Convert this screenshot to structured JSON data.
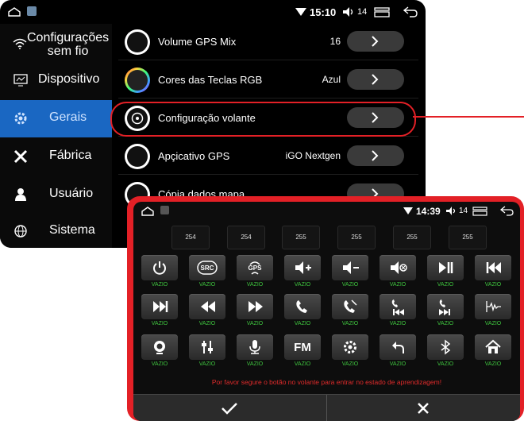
{
  "back_screen": {
    "status": {
      "time": "15:10",
      "volume": "14"
    },
    "sidebar": [
      {
        "label": "Configurações\nsem fio",
        "icon": "wifi-icon",
        "active": false
      },
      {
        "label": "Dispositivo",
        "icon": "device-icon",
        "active": false
      },
      {
        "label": "Gerais",
        "icon": "gear-icon",
        "active": true
      },
      {
        "label": "Fábrica",
        "icon": "tools-icon",
        "active": false
      },
      {
        "label": "Usuário",
        "icon": "user-icon",
        "active": false
      },
      {
        "label": "Sistema",
        "icon": "globe-icon",
        "active": false
      }
    ],
    "settings": [
      {
        "title": "Volume GPS Mix",
        "value": "16",
        "icon": "gps-mix-icon"
      },
      {
        "title": "Cores das Teclas RGB",
        "value": "Azul",
        "icon": "rgb-bulb-icon"
      },
      {
        "title": "Configuração volante",
        "value": "",
        "icon": "steering-wheel-icon"
      },
      {
        "title": "Apçicativo GPS",
        "value": "iGO Nextgen",
        "icon": "gps-app-icon"
      },
      {
        "title": "Cópia dados mapa",
        "value": "",
        "icon": "map-icon"
      }
    ]
  },
  "front_screen": {
    "status": {
      "time": "14:39",
      "volume": "14"
    },
    "codes": [
      "254",
      "254",
      "255",
      "255",
      "255",
      "255"
    ],
    "keys": [
      [
        {
          "icon": "power-icon",
          "status": "VAZIO"
        },
        {
          "icon": "src-icon",
          "text": "SRC",
          "status": "VAZIO"
        },
        {
          "icon": "gps-key-icon",
          "text": "GPS",
          "status": "VAZIO"
        },
        {
          "icon": "volume-up-icon",
          "status": "VAZIO"
        },
        {
          "icon": "volume-down-icon",
          "status": "VAZIO"
        },
        {
          "icon": "mute-icon",
          "status": "VAZIO"
        },
        {
          "icon": "play-pause-icon",
          "status": "VAZIO"
        },
        {
          "icon": "previous-track-icon",
          "status": "VAZIO"
        }
      ],
      [
        {
          "icon": "next-track-icon",
          "status": "VAZIO"
        },
        {
          "icon": "rewind-icon",
          "status": "VAZIO"
        },
        {
          "icon": "fast-forward-icon",
          "status": "VAZIO"
        },
        {
          "icon": "call-answer-icon",
          "status": "VAZIO"
        },
        {
          "icon": "call-hangup-icon",
          "status": "VAZIO"
        },
        {
          "icon": "call-previous-icon",
          "status": "VAZIO"
        },
        {
          "icon": "call-next-icon",
          "status": "VAZIO"
        },
        {
          "icon": "audio-wave-icon",
          "status": "VAZIO"
        }
      ],
      [
        {
          "icon": "camera-icon",
          "status": "VAZIO"
        },
        {
          "icon": "equalizer-icon",
          "status": "VAZIO"
        },
        {
          "icon": "microphone-icon",
          "status": "VAZIO"
        },
        {
          "icon": "fm-icon",
          "text": "FM",
          "status": "VAZIO"
        },
        {
          "icon": "settings-key-icon",
          "status": "VAZIO"
        },
        {
          "icon": "back-icon",
          "status": "VAZIO"
        },
        {
          "icon": "bluetooth-icon",
          "status": "VAZIO"
        },
        {
          "icon": "home-icon",
          "status": "VAZIO"
        }
      ]
    ],
    "instruction": "Por favor segure o botão no volante para entrar no estado de aprendizagem!",
    "confirm_icon": "check-icon",
    "cancel_icon": "close-icon"
  },
  "colors": {
    "accent_blue": "#1a67c2",
    "highlight_red": "#e32026",
    "status_green": "#3fc53f",
    "instruction_red": "#e12b2b"
  }
}
